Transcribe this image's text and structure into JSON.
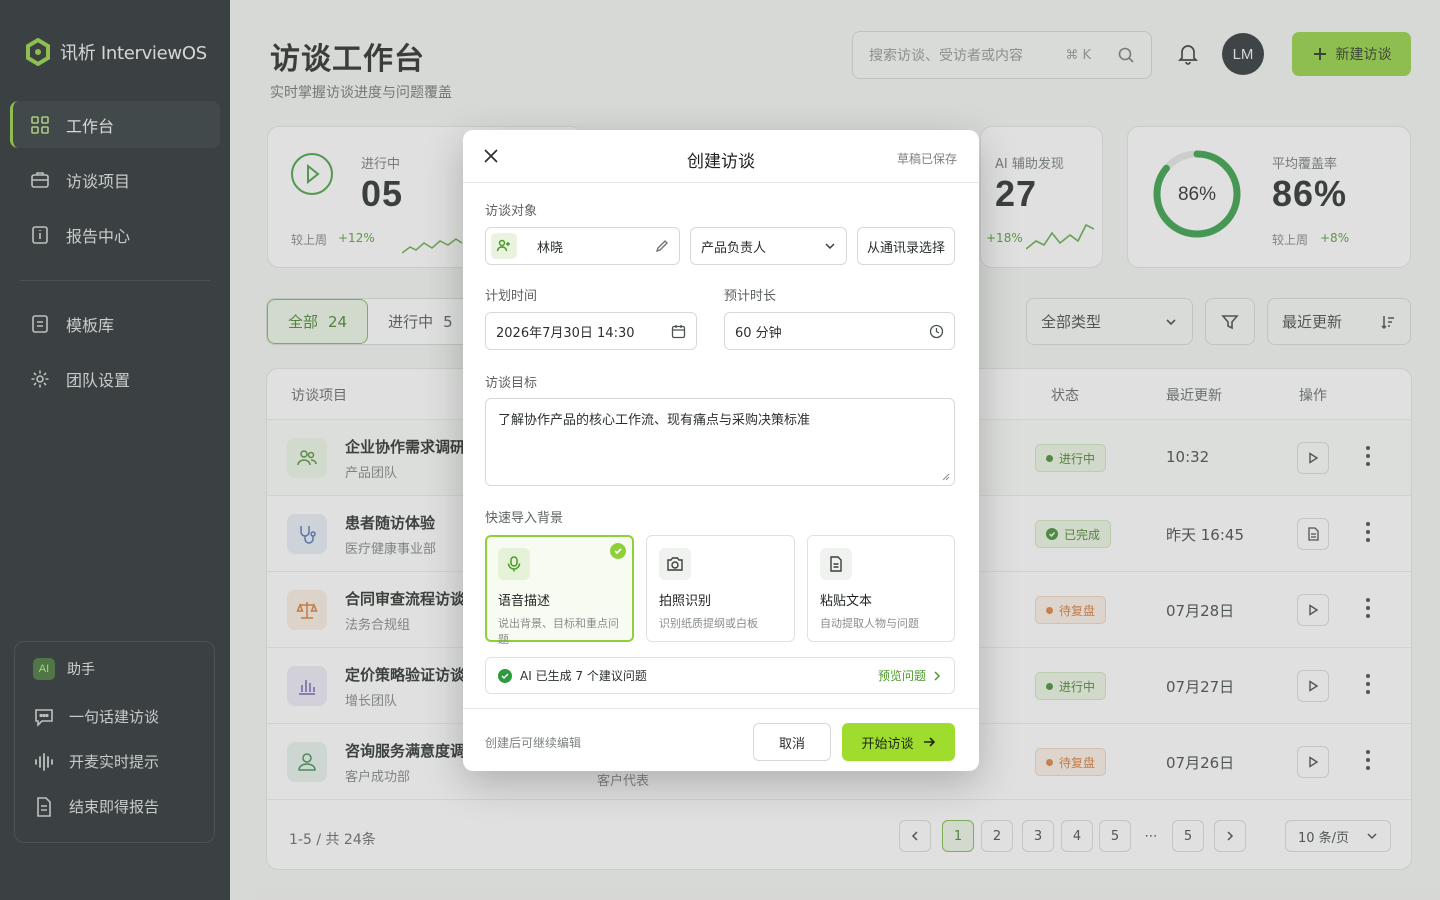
{
  "brand": {
    "name": "讯析 InterviewOS"
  },
  "sidebar": {
    "items": [
      {
        "label": "工作台"
      },
      {
        "label": "访谈项目"
      },
      {
        "label": "报告中心"
      },
      {
        "label": "模板库"
      },
      {
        "label": "团队设置"
      }
    ],
    "assistant": {
      "badge": "AI",
      "title": "助手",
      "items": [
        {
          "label": "一句话建访谈"
        },
        {
          "label": "开麦实时提示"
        },
        {
          "label": "结束即得报告"
        }
      ]
    }
  },
  "header": {
    "title": "访谈工作台",
    "subtitle": "实时掌握访谈进度与问题覆盖",
    "search_placeholder": "搜索访谈、受访者或内容",
    "search_shortcut": "⌘ K",
    "avatar": "LM",
    "new_button": "新建访谈"
  },
  "stats": {
    "in_progress": {
      "label": "进行中",
      "value": "05",
      "compare_label": "较上周",
      "delta": "+12%"
    },
    "ai_found": {
      "label": "AI 辅助发现",
      "value": "27",
      "delta": "+18%"
    },
    "coverage": {
      "label": "平均覆盖率",
      "value": "86%",
      "ring_text": "86%",
      "ring_fraction": 0.86,
      "compare_label": "较上周",
      "delta": "+8%"
    }
  },
  "filters": {
    "tabs": [
      {
        "label": "全部",
        "count": "24"
      },
      {
        "label": "进行中",
        "count": "5"
      }
    ],
    "type_select": "全部类型",
    "sort_select": "最近更新"
  },
  "table": {
    "headers": {
      "project": "访谈项目",
      "status": "状态",
      "updated": "最近更新",
      "action": "操作"
    },
    "rows": [
      {
        "title": "企业协作需求调研",
        "team": "产品团队",
        "status": "进行中",
        "updated": "10:32"
      },
      {
        "title": "患者随访体验",
        "team": "医疗健康事业部",
        "status": "已完成",
        "updated": "昨天 16:45"
      },
      {
        "title": "合同审查流程访谈",
        "team": "法务合规组",
        "status": "待复盘",
        "updated": "07月28日"
      },
      {
        "title": "定价策略验证访谈",
        "team": "增长团队",
        "status": "进行中",
        "updated": "07月27日"
      },
      {
        "title": "咨询服务满意度调",
        "team": "客户成功部",
        "status": "待复盘",
        "updated": "07月26日",
        "extra": "客户代表"
      }
    ],
    "pagination": {
      "info": "1-5 / 共 24条",
      "pages": [
        "1",
        "2",
        "3",
        "4",
        "5",
        "⋯",
        "5"
      ],
      "page_size": "10 条/页"
    }
  },
  "colors": {
    "accent": "#8fd03a",
    "sidebar": "#1c2227",
    "pending": "#e07a34"
  },
  "modal": {
    "title": "创建访谈",
    "draft_status": "草稿已保存",
    "subject_label": "访谈对象",
    "subject_name": "林晓",
    "subject_role": "产品负责人",
    "contacts_button": "从通讯录选择",
    "time_label": "计划时间",
    "time_value": "2026年7月30日 14:30",
    "duration_label": "预计时长",
    "duration_value": "60 分钟",
    "goal_label": "访谈目标",
    "goal_value": "了解协作产品的核心工作流、现有痛点与采购决策标准",
    "import_label": "快速导入背景",
    "import_options": [
      {
        "title": "语音描述",
        "desc": "说出背景、目标和重点问题",
        "icon": "mic-icon",
        "selected": true
      },
      {
        "title": "拍照识别",
        "desc": "识别纸质提纲或白板",
        "icon": "camera-icon",
        "selected": false
      },
      {
        "title": "粘贴文本",
        "desc": "自动提取人物与问题",
        "icon": "document-icon",
        "selected": false
      }
    ],
    "ai_note": "AI 已生成 7 个建议问题",
    "preview_link": "预览问题",
    "footer_hint": "创建后可继续编辑",
    "cancel_button": "取消",
    "start_button": "开始访谈"
  }
}
